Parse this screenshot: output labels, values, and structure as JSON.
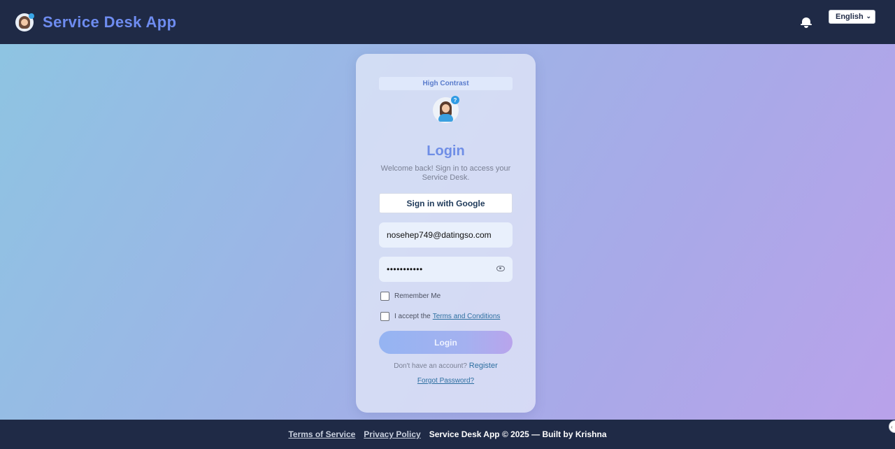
{
  "header": {
    "app_title": "Service Desk App",
    "language": "English"
  },
  "card": {
    "high_contrast_label": "High Contrast",
    "title": "Login",
    "subtitle": "Welcome back! Sign in to access your Service Desk.",
    "google_label": "Sign in with Google",
    "email_value": "nosehep749@datingso.com",
    "password_masked": "•••••••••••",
    "remember_label": "Remember Me",
    "terms_prefix": "I accept the",
    "terms_link": "Terms and Conditions",
    "login_label": "Login",
    "no_account_text": "Don't have an account?",
    "register_label": "Register",
    "forgot_label": "Forgot Password?"
  },
  "footer": {
    "terms_link": "Terms of Service",
    "privacy_link": "Privacy Policy",
    "copyright": "Service Desk App © 2025 — Built by Krishna"
  },
  "colors": {
    "header_bg": "#1f2a46",
    "accent": "#6f8ee6",
    "link": "#2d6fa0"
  }
}
